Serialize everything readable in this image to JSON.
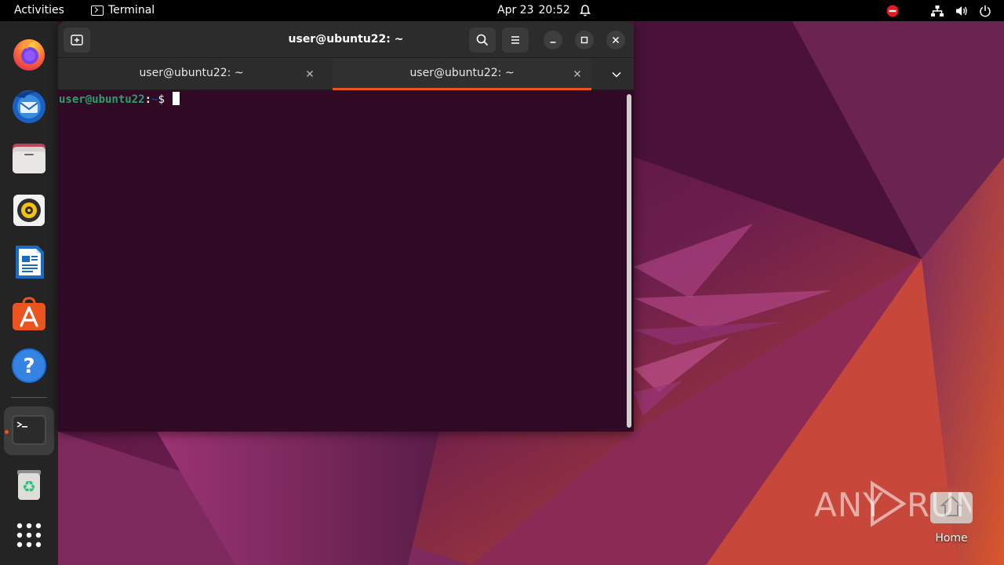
{
  "topbar": {
    "activities": "Activities",
    "app_name": "Terminal",
    "date": "Apr 23",
    "time": "20:52"
  },
  "dock": {
    "items": [
      {
        "name": "Firefox",
        "icon": "firefox-icon"
      },
      {
        "name": "Thunderbird",
        "icon": "thunderbird-icon"
      },
      {
        "name": "Files",
        "icon": "files-icon"
      },
      {
        "name": "Rhythmbox",
        "icon": "rhythmbox-icon"
      },
      {
        "name": "LibreOffice Writer",
        "icon": "writer-icon"
      },
      {
        "name": "Ubuntu Software",
        "icon": "software-icon"
      },
      {
        "name": "Help",
        "icon": "help-icon"
      },
      {
        "name": "Terminal",
        "icon": "terminal-icon",
        "running": true
      },
      {
        "name": "Trash",
        "icon": "trash-icon"
      },
      {
        "name": "Show Applications",
        "icon": "app-grid-icon"
      }
    ]
  },
  "terminal": {
    "title": "user@ubuntu22: ~",
    "tabs": [
      {
        "label": "user@ubuntu22: ~",
        "active": false
      },
      {
        "label": "user@ubuntu22: ~",
        "active": true
      }
    ],
    "prompt": {
      "user_host": "user@ubuntu22",
      "colon": ":",
      "path": "~",
      "symbol": "$ "
    }
  },
  "desktop": {
    "home_label": "Home"
  },
  "watermark": {
    "text": "ANY RUN"
  },
  "colors": {
    "accent": "#e95420",
    "terminal_bg": "#300a24",
    "prompt_user": "#26a269",
    "prompt_path": "#12488b"
  }
}
